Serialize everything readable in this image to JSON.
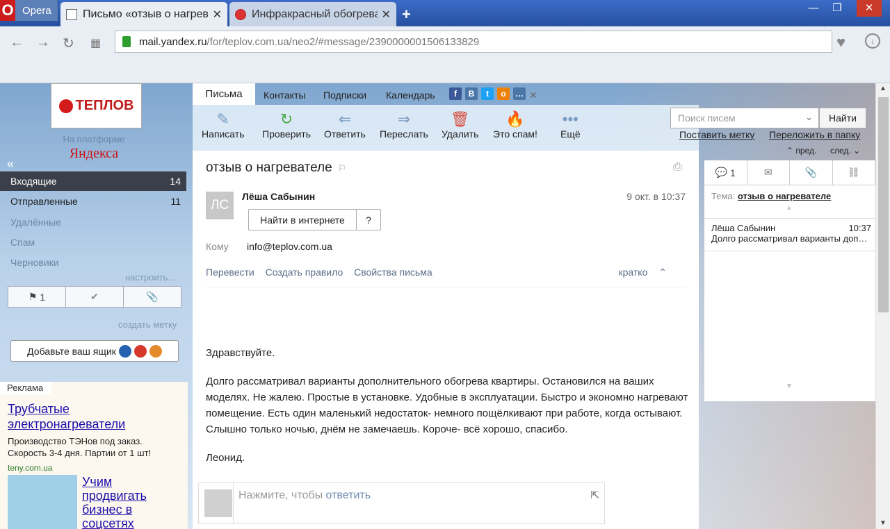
{
  "browser": {
    "menu_label": "Opera",
    "tabs": [
      {
        "title": "Письмо «отзыв о нагрева"
      },
      {
        "title": "Инфракрасный обогрева"
      }
    ],
    "new_tab": "+",
    "url_domain": "mail.yandex.ru",
    "url_path": "/for/teplov.com.ua/neo2/#message/2390000001506133829"
  },
  "sidebar": {
    "logo_text": "ТЕПЛОВ",
    "powered": "На платформе",
    "yandex": "Яндекса",
    "folders": [
      {
        "label": "Входящие",
        "count": "14"
      },
      {
        "label": "Отправленные",
        "count": "11"
      },
      {
        "label": "Удалённые",
        "count": ""
      },
      {
        "label": "Спам",
        "count": ""
      },
      {
        "label": "Черновики",
        "count": ""
      }
    ],
    "setup": "настроить...",
    "flag_count": "1",
    "create_label": "создать метку",
    "add_box": "Добавьте ваш ящик"
  },
  "ads": {
    "label": "Реклама",
    "ad1_title": "Трубчатые электронагреватели",
    "ad1_text": "Производство ТЭНов под заказ. Скорость 3-4 дня. Партии от 1 шт!",
    "ad1_domain": "teny.com.ua",
    "ad2_title": "Учим продвигать бизнес в соцсетях"
  },
  "maintabs": {
    "letters": "Письма",
    "contacts": "Контакты",
    "subscriptions": "Подписки",
    "calendar": "Календарь"
  },
  "actions": {
    "write": "Написать",
    "check": "Проверить",
    "reply": "Ответить",
    "forward": "Переслать",
    "delete": "Удалить",
    "spam": "Это спам!",
    "more": "Ещё"
  },
  "search": {
    "placeholder": "Поиск писем",
    "button": "Найти",
    "set_label": "Поставить метку",
    "move": "Переложить в папку",
    "prev": "пред.",
    "next": "след."
  },
  "message": {
    "subject": "отзыв о нагревателе",
    "avatar_initials": "ЛС",
    "sender": "Лёша Сабынин",
    "date": "9 окт. в 10:37",
    "find_button": "Найти в интернете",
    "q_button": "?",
    "to_label": "Кому",
    "to": "info@teplov.com.ua",
    "link_translate": "Перевести",
    "link_rule": "Создать правило",
    "link_props": "Свойства письма",
    "short": "кратко",
    "body_greeting": "Здравствуйте.",
    "body_main": "Долго рассматривал варианты дополнительного обогрева квартиры. Остановился на ваших моделях. Не жалею. Простые в установке. Удобные в эксплуатации. Быстро и экономно нагревают помещение. Есть один маленький недостаток- немного пощёлкивают при работе, когда остывают. Слышно только ночью, днём не замечаешь. Короче- всё хорошо, спасибо.",
    "body_sign": "Леонид.",
    "reply_prompt": "Нажмите, чтобы",
    "reply_link": "ответить"
  },
  "thread": {
    "count": "1",
    "topic_label": "Тема:",
    "topic": "отзыв о нагревателе",
    "item_sender": "Лёша Сабынин",
    "item_time": "10:37",
    "item_preview": "Долго рассматривал варианты дополнительного обогрева"
  }
}
